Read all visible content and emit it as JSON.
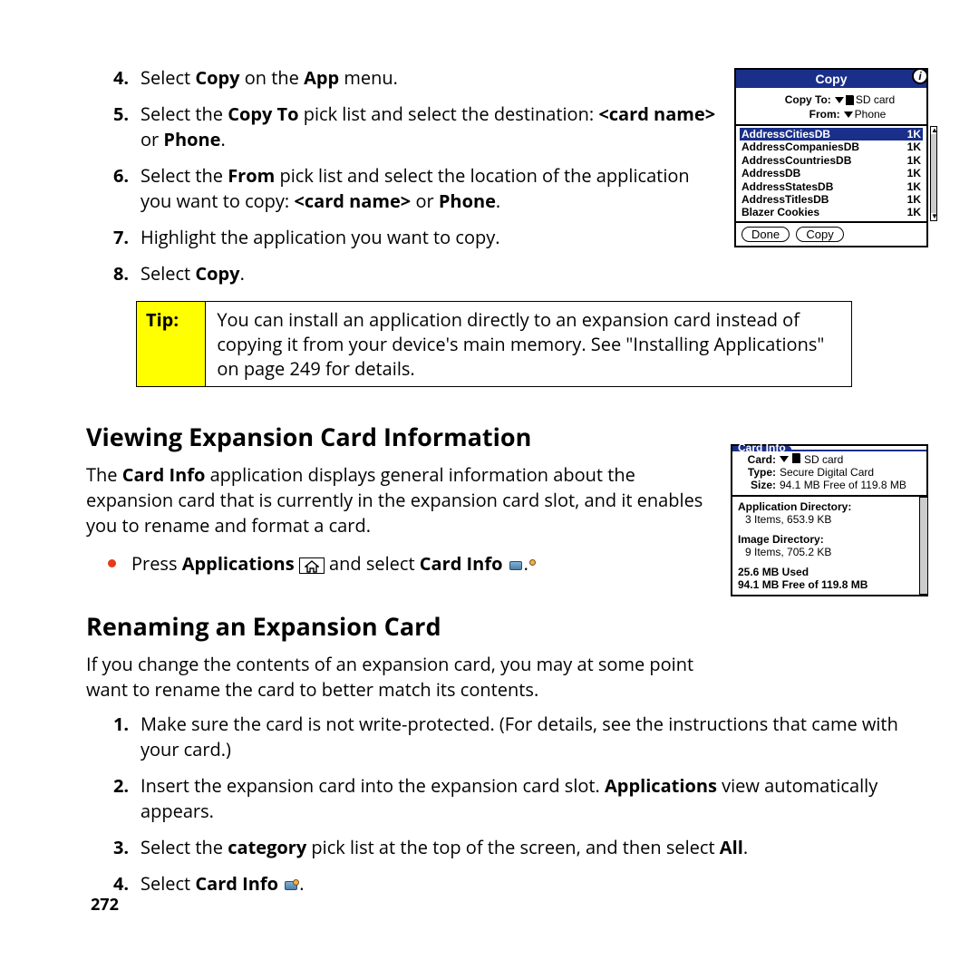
{
  "page_number": "272",
  "steps_top": [
    {
      "n": "4.",
      "parts": [
        "Select ",
        {
          "b": "Copy"
        },
        " on the ",
        {
          "b": "App"
        },
        " menu."
      ]
    },
    {
      "n": "5.",
      "parts": [
        "Select the ",
        {
          "b": "Copy To"
        },
        " pick list and select the destination: ",
        {
          "b": "<card name>"
        },
        " or ",
        {
          "b": "Phone"
        },
        "."
      ]
    },
    {
      "n": "6.",
      "parts": [
        "Select the ",
        {
          "b": "From"
        },
        " pick list and select the location of the application you want to copy: ",
        {
          "b": "<card name>"
        },
        " or ",
        {
          "b": "Phone"
        },
        "."
      ]
    },
    {
      "n": "7.",
      "parts": [
        "Highlight the application you want to copy."
      ]
    },
    {
      "n": "8.",
      "parts": [
        "Select ",
        {
          "b": "Copy"
        },
        "."
      ]
    }
  ],
  "copy_dialog": {
    "title": "Copy",
    "copy_to_label": "Copy To:",
    "copy_to_value": "SD card",
    "from_label": "From:",
    "from_value": "Phone",
    "items": [
      {
        "name": "AddressCitiesDB",
        "size": "1K",
        "sel": true
      },
      {
        "name": "AddressCompaniesDB",
        "size": "1K"
      },
      {
        "name": "AddressCountriesDB",
        "size": "1K"
      },
      {
        "name": "AddressDB",
        "size": "1K"
      },
      {
        "name": "AddressStatesDB",
        "size": "1K"
      },
      {
        "name": "AddressTitlesDB",
        "size": "1K"
      },
      {
        "name": "Blazer Cookies",
        "size": "1K"
      }
    ],
    "btn_done": "Done",
    "btn_copy": "Copy"
  },
  "tip": {
    "label": "Tip:",
    "body": "You can install an application directly to an expansion card instead of copying it from your device's main memory. See \"Installing Applications\" on page 249 for details."
  },
  "sec1": {
    "heading": "Viewing Expansion Card Information",
    "body": [
      "The ",
      {
        "b": "Card Info"
      },
      " application displays general information about the expansion card that is currently in the expansion card slot, and it enables you to rename and format a card."
    ],
    "bullet": [
      "Press ",
      {
        "b": "Applications"
      },
      " ",
      {
        "icon": "home"
      },
      " and select ",
      {
        "b": "Card Info"
      },
      " ",
      {
        "icon": "app"
      },
      "."
    ]
  },
  "cardinfo": {
    "title": "Card Info",
    "card_label": "Card:",
    "card_value": "SD card",
    "type_label": "Type:",
    "type_value": "Secure Digital Card",
    "size_label": "Size:",
    "size_value": "94.1 MB Free of 119.8 MB",
    "appdir_t": "Application Directory:",
    "appdir_v": "3 Items, 653.9 KB",
    "imgdir_t": "Image Directory:",
    "imgdir_v": "9 Items, 705.2 KB",
    "used": "25.6 MB Used",
    "free": "94.1 MB Free of 119.8 MB"
  },
  "sec2": {
    "heading": "Renaming an Expansion Card",
    "intro": "If you change the contents of an expansion card, you may at some point want to rename the card to better match its contents.",
    "steps": [
      {
        "n": "1.",
        "parts": [
          "Make sure the card is not write-protected. (For details, see the instructions that came with your card.)"
        ]
      },
      {
        "n": "2.",
        "parts": [
          "Insert the expansion card into the expansion card slot. ",
          {
            "b": "Applications"
          },
          " view automatically appears."
        ]
      },
      {
        "n": "3.",
        "parts": [
          "Select the ",
          {
            "b": "category"
          },
          " pick list at the top of the screen, and then select ",
          {
            "b": "All"
          },
          "."
        ]
      },
      {
        "n": "4.",
        "parts": [
          "Select ",
          {
            "b": "Card Info"
          },
          " ",
          {
            "icon": "app"
          },
          "."
        ]
      }
    ]
  }
}
